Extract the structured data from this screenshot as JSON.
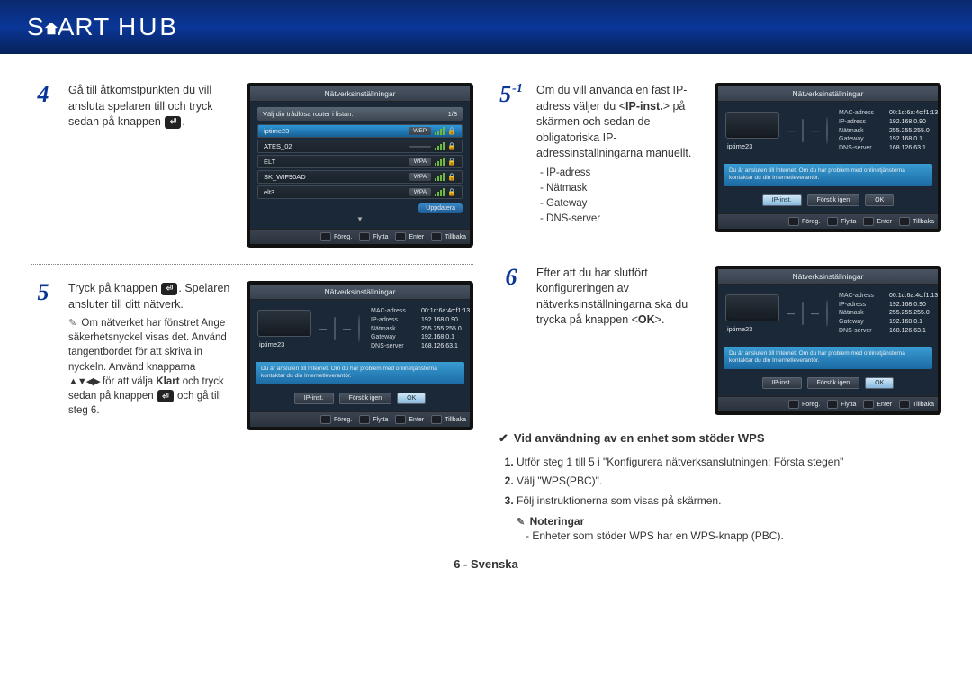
{
  "header": {
    "brand_s": "S",
    "brand_art": "ART",
    "brand_hub": "HUB"
  },
  "footer_page": "6 - Svenska",
  "ui": {
    "title": "Nätverksinställningar",
    "footer": {
      "prev": "Föreg.",
      "move": "Flytta",
      "enter": "Enter",
      "back": "Tillbaka"
    },
    "wifi": {
      "prompt": "Välj din trådlösa router i listan:",
      "page": "1/8",
      "rows": [
        {
          "ssid": "iptime23",
          "sec": "WEP"
        },
        {
          "ssid": "ATES_02",
          "sec": ""
        },
        {
          "ssid": "ELT",
          "sec": "WPA"
        },
        {
          "ssid": "SK_WIF90AD",
          "sec": "WPA"
        },
        {
          "ssid": "elt3",
          "sec": "WPA"
        }
      ],
      "update": "Uppdatera"
    },
    "net": {
      "ssid": "iptime23",
      "fields": {
        "mac": {
          "k": "MAC-adress",
          "v": "00:1d:6a:4c:f1:13"
        },
        "ip": {
          "k": "IP-adress",
          "v": "192.168.0.90"
        },
        "mask": {
          "k": "Nätmask",
          "v": "255.255.255.0"
        },
        "gw": {
          "k": "Gateway",
          "v": "192.168.0.1"
        },
        "dns": {
          "k": "DNS-server",
          "v": "168.126.63.1"
        }
      },
      "msg": "Du är ansluten till Internet. Om du har problem med onlinetjänsterna kontaktar du din Internetleverantör.",
      "btns": {
        "ip": "IP-inst.",
        "retry": "Försök igen",
        "ok": "OK"
      }
    }
  },
  "steps": {
    "4": {
      "text_a": "Gå till åtkomstpunkten du vill ansluta spelaren till och tryck sedan på knappen ",
      "text_b": "."
    },
    "5": {
      "text_a": "Tryck på knappen ",
      "text_b": ". Spelaren ansluter till ditt nätverk.",
      "note1": "Om nätverket har fönstret Ange säkerhetsnyckel visas det. Använd tangentbordet för att skriva in nyckeln. Använd knapparna",
      "note2_arrows": "▲▼◀▶",
      "note2_a": " för att välja ",
      "note2_b": "Klart",
      "note2_c": " och tryck sedan på knappen ",
      "note2_d": " och gå till steg 6."
    },
    "5_1": {
      "num_sub": "-1",
      "text_a": "Om du vill använda en fast IP-adress väljer du <",
      "text_b": "IP-inst.",
      "text_c": "> på skärmen och sedan de obligatoriska IP-adressinställningarna manuellt.",
      "list": [
        "IP-adress",
        "Nätmask",
        "Gateway",
        "DNS-server"
      ]
    },
    "6": {
      "text_a": "Efter att du har slutfört konfigureringen av nätverksinställningarna ska du trycka på knappen <",
      "text_b": "OK",
      "text_c": ">."
    }
  },
  "wps": {
    "title": "Vid användning av en enhet som stöder WPS",
    "items": [
      "Utför steg 1 till 5 i \"Konfigurera nätverksanslutningen: Första stegen\"",
      "Välj \"WPS(PBC)\".",
      "Följ instruktionerna som visas på skärmen."
    ],
    "notes_label": "Noteringar",
    "notes_body": "Enheter som stöder WPS har en WPS-knapp (PBC)."
  }
}
